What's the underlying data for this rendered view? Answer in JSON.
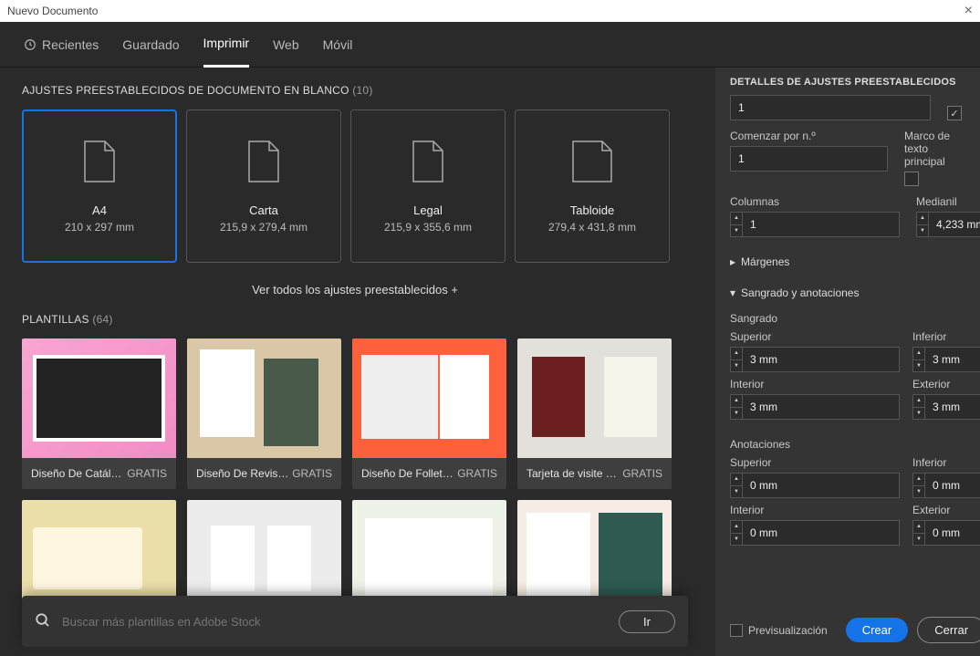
{
  "window": {
    "title": "Nuevo Documento"
  },
  "tabs": {
    "recent": "Recientes",
    "saved": "Guardado",
    "print": "Imprimir",
    "web": "Web",
    "mobile": "Móvil"
  },
  "presets_header": {
    "label": "AJUSTES PREESTABLECIDOS DE DOCUMENTO EN BLANCO",
    "count": "(10)"
  },
  "presets": [
    {
      "name": "A4",
      "dim": "210 x 297 mm"
    },
    {
      "name": "Carta",
      "dim": "215,9 x 279,4 mm"
    },
    {
      "name": "Legal",
      "dim": "215,9 x 355,6 mm"
    },
    {
      "name": "Tabloide",
      "dim": "279,4 x 431,8 mm"
    }
  ],
  "view_all": "Ver todos los ajustes preestablecidos +",
  "templates_header": {
    "label": "PLANTILLAS",
    "count": "(64)"
  },
  "templates": [
    {
      "title": "Diseño De Catálog...",
      "price": "GRATIS"
    },
    {
      "title": "Diseño De Revista...",
      "price": "GRATIS"
    },
    {
      "title": "Diseño De Folleto...",
      "price": "GRATIS"
    },
    {
      "title": "Tarjeta de visite si...",
      "price": "GRATIS"
    }
  ],
  "search": {
    "placeholder": "Buscar más plantillas en Adobe Stock",
    "go": "Ir"
  },
  "panel": {
    "title": "DETALLES DE AJUSTES PREESTABLECIDOS",
    "pages_value": "1",
    "facing_checked": "✓",
    "start_label": "Comenzar por n.º",
    "start_value": "1",
    "textframe_label": "Marco de texto principal",
    "columns_label": "Columnas",
    "columns_value": "1",
    "gutter_label": "Medianil",
    "gutter_value": "4,233 mm",
    "margins_label": "Márgenes",
    "bleed_label": "Sangrado y anotaciones",
    "bleed_sub": "Sangrado",
    "top": "Superior",
    "bottom": "Inferior",
    "inside": "Interior",
    "outside": "Exterior",
    "bleed_top": "3 mm",
    "bleed_bottom": "3 mm",
    "bleed_inside": "3 mm",
    "bleed_outside": "3 mm",
    "slug_sub": "Anotaciones",
    "slug_top": "0 mm",
    "slug_bottom": "0 mm",
    "slug_inside": "0 mm",
    "slug_outside": "0 mm",
    "preview": "Previsualización",
    "create": "Crear",
    "close": "Cerrar"
  }
}
